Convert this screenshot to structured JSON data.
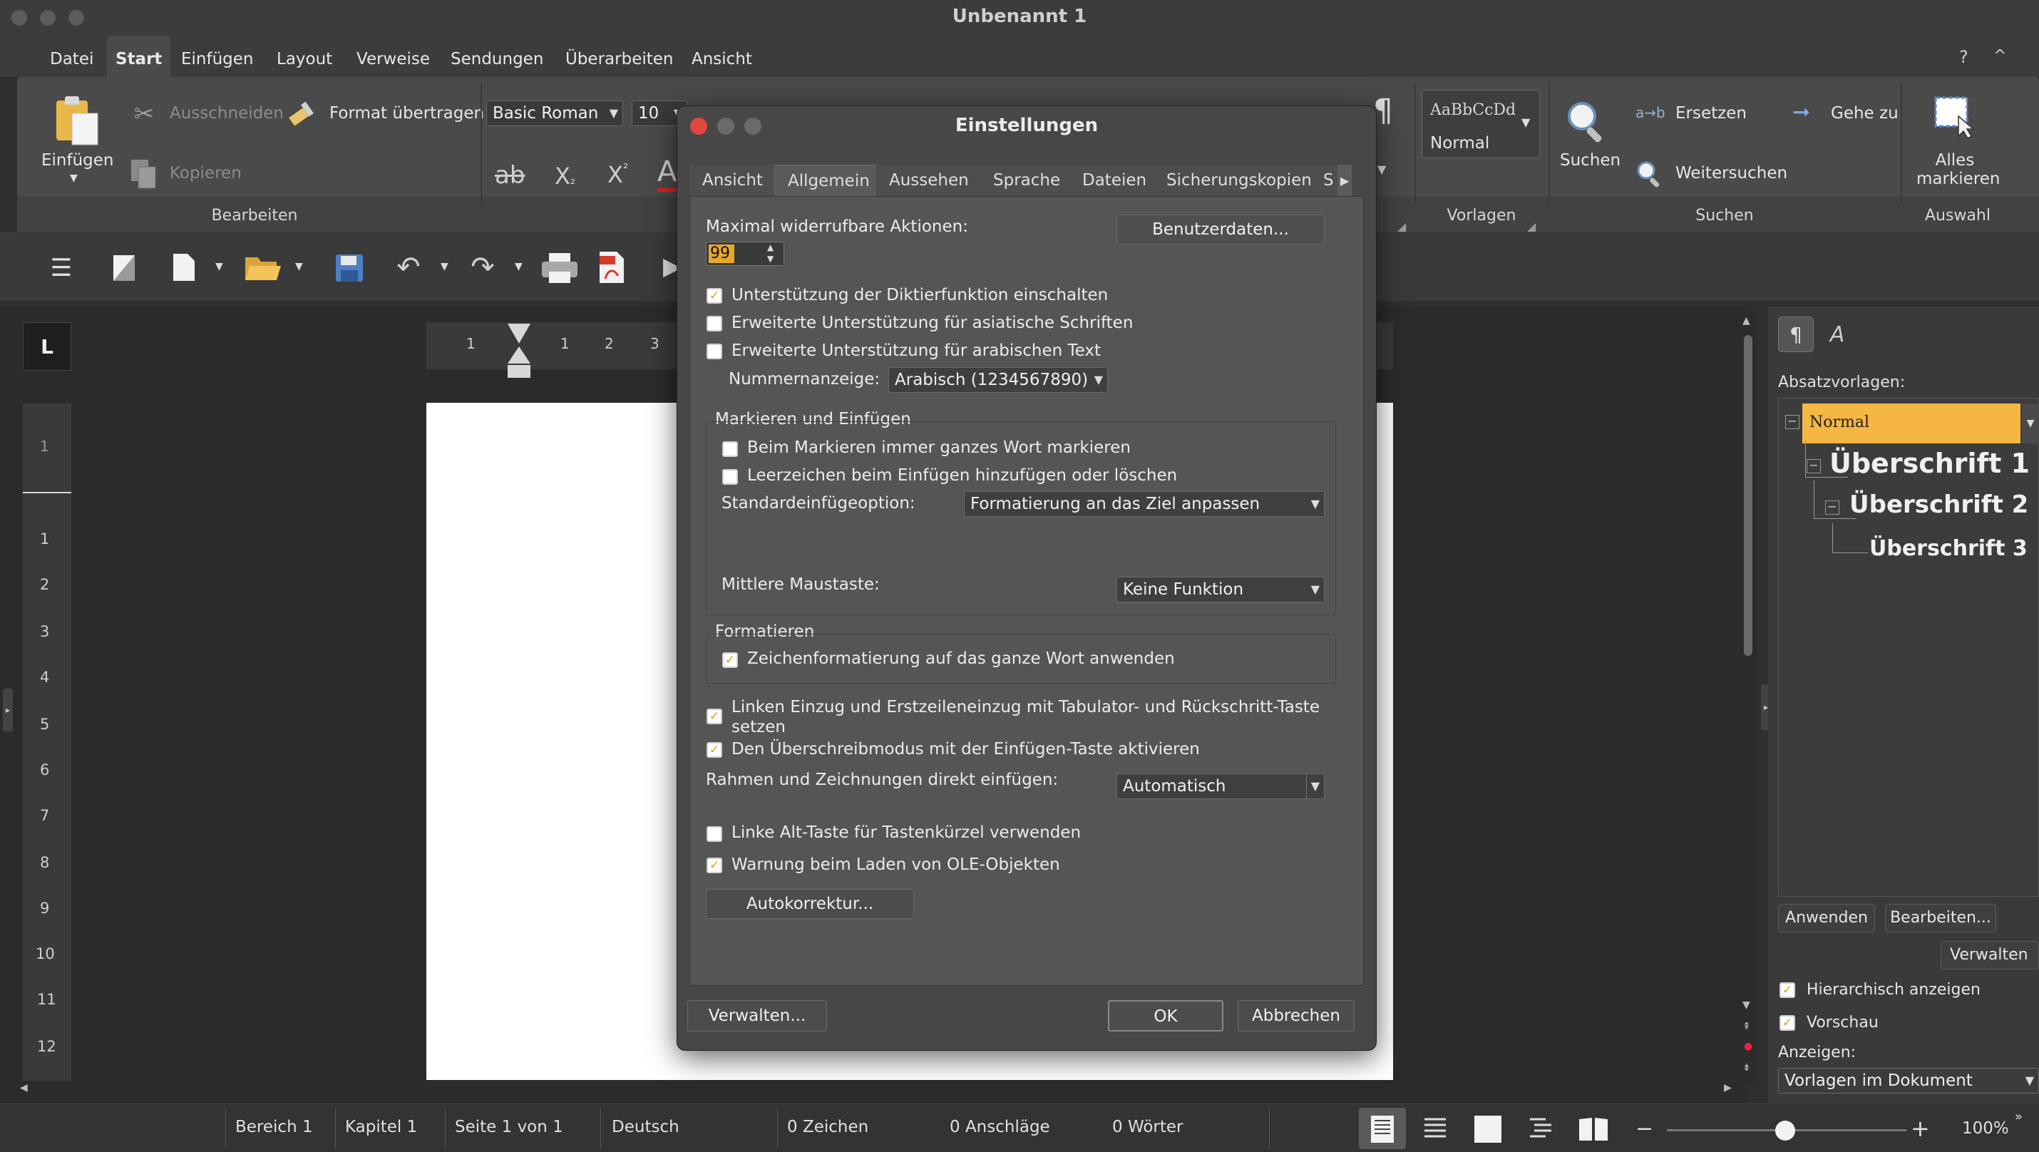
{
  "window": {
    "title": "Unbenannt 1"
  },
  "menu": [
    "Datei",
    "Start",
    "Einfügen",
    "Layout",
    "Verweise",
    "Sendungen",
    "Überarbeiten",
    "Ansicht"
  ],
  "menu_right": {
    "help": "?",
    "collapse": "^"
  },
  "ribbon": {
    "paste_label": "Einfügen",
    "cut_label": "Ausschneiden",
    "copy_label": "Kopieren",
    "format_paint_label": "Format übertragen",
    "font_name": "Basic Roman",
    "font_size": "10",
    "strike_sample": "ab",
    "sub_sample": "X",
    "sub_mark": "₂",
    "sup_sample": "X",
    "sup_mark": "²",
    "color_sample": "A",
    "style_preview_sample": "AaBbCcDd",
    "style_preview_name": "Normal",
    "search_label": "Suchen",
    "replace_label": "Ersetzen",
    "replace_prefix": "a→b",
    "goto_label": "Gehe zu",
    "find_next_label": "Weitersuchen",
    "select_all_label": "Alles markieren",
    "group_bearbeiten": "Bearbeiten",
    "group_vorlagen": "Vorlagen",
    "group_suchen": "Suchen",
    "group_auswahl": "Auswahl"
  },
  "ruler": {
    "tab_symbol": "L",
    "h_ticks": [
      "1",
      "1",
      "2",
      "3"
    ],
    "v_ticks": [
      "1",
      "1",
      "2",
      "3",
      "4",
      "5",
      "6",
      "7",
      "8",
      "9",
      "10",
      "11",
      "12"
    ]
  },
  "dialog": {
    "title": "Einstellungen",
    "tabs": [
      "Ansicht",
      "Allgemein",
      "Aussehen",
      "Sprache",
      "Dateien",
      "Sicherungskopien",
      "S"
    ],
    "max_undo_label": "Maximal widerrufbare Aktionen:",
    "max_undo_value": "99",
    "user_data_button": "Benutzerdaten...",
    "dictation": "Unterstützung der Diktierfunktion einschalten",
    "asian": "Erweiterte Unterstützung für asiatische Schriften",
    "arabic": "Erweiterte Unterstützung für arabischen Text",
    "number_display_label": "Nummernanzeige:",
    "number_display_value": "Arabisch (1234567890)",
    "select_paste_group": "Markieren und Einfügen",
    "select_whole_word": "Beim Markieren immer ganzes Wort markieren",
    "space_on_paste": "Leerzeichen beim Einfügen hinzufügen oder löschen",
    "std_paste_label": "Standardeinfügeoption:",
    "std_paste_value": "Formatierung an das Ziel anpassen",
    "middle_mouse_label": "Mittlere Maustaste:",
    "middle_mouse_value": "Keine Funktion",
    "format_group": "Formatieren",
    "char_format_whole_word": "Zeichenformatierung auf das ganze Wort anwenden",
    "indent_tab_line1": "Linken Einzug und Erstzeileneinzug mit Tabulator- und Rückschritt-Taste",
    "indent_tab_line2": "setzen",
    "overwrite_mode": "Den Überschreibmodus mit der Einfügen-Taste aktivieren",
    "frames_label": "Rahmen und Zeichnungen direkt einfügen:",
    "frames_value": "Automatisch",
    "left_alt": "Linke Alt-Taste für Tastenkürzel verwenden",
    "ole_warning": "Warnung beim Laden von OLE-Objekten",
    "autocorrect_button": "Autokorrektur...",
    "manage_button": "Verwalten...",
    "ok_button": "OK",
    "cancel_button": "Abbrechen"
  },
  "sidebar": {
    "para_styles_label": "Absatzvorlagen:",
    "styles": [
      "Normal",
      "Überschrift 1",
      "Überschrift 2",
      "Überschrift 3"
    ],
    "apply_button": "Anwenden",
    "edit_button": "Bearbeiten...",
    "manage_button": "Verwalten",
    "hierarchical": "Hierarchisch anzeigen",
    "preview": "Vorschau",
    "show_label": "Anzeigen:",
    "show_value": "Vorlagen im Dokument"
  },
  "status": {
    "area": "Bereich 1",
    "chapter": "Kapitel 1",
    "page": "Seite 1 von 1",
    "language": "Deutsch",
    "chars": "0 Zeichen",
    "keystrokes": "0 Anschläge",
    "words": "0 Wörter",
    "zoom": "100%"
  },
  "colors": {
    "accent": "#e89a1f",
    "style_highlight": "#f5b642",
    "close_red": "#e0473e"
  }
}
